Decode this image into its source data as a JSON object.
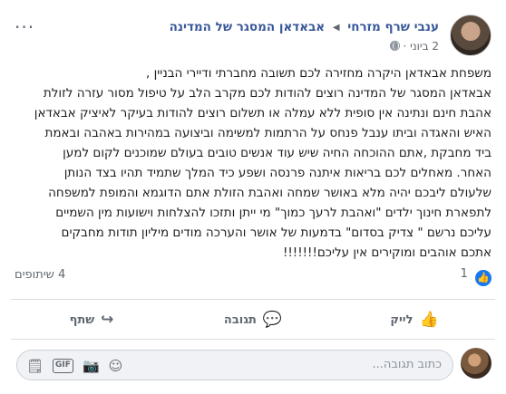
{
  "header": {
    "author": "ענבי שרף מזרחי",
    "group": "אבאדאן המסגר של המדינה",
    "date": "2 ביוני"
  },
  "post": {
    "lines": [
      "משפחת אבאדאן היקרה מחזירה לכם תשובה מחברתי ודיירי הבניין ,",
      "אבאדאן המסגר של המדינה רוצים להודות לכם מקרב הלב על טיפול מסור עזרה לזולת",
      "אהבת חינם ונתינה אין סופית ללא עמלה או תשלום רוצים להודות בעיקר לאיציק אבאדאן",
      "האיש והאגדה וביתו ענבל פנחס על הרתמות למשימה וביצועה במהירות באהבה ובאמת",
      "ביד מחבקת ,אתם ההוכחה החיה שיש עוד אנשים טובים בעולם שמוכנים לקום למען",
      "האחר. מאחלים לכם בריאות איתנה פרנסה ושפע כיד המלך שתמיד תהיו בצד הנותן",
      "שלעולם ליבכם יהיה מלא באושר שמחה ואהבת הזולת אתם הדוגמא והמופת למשפחה",
      "לתפארת חינוך ילדים \"ואהבת לרעך כמוך\" מי ייתן ותזכו להצלחות וישועות מין השמיים",
      "עליכם נרשם \" צדיק בסדום\" בדמעות של אושר והערכה מודים מיליון תודות מחבקים",
      "אתכם אוהבים ומוקירים אין עליכם!!!!!!!"
    ]
  },
  "stats": {
    "likes": "1",
    "shares": "4 שיתופים"
  },
  "actions": {
    "like": "לייק",
    "comment": "תגובה",
    "share": "שתף"
  },
  "comment_box": {
    "placeholder": "כתוב תגובה..."
  },
  "colors": {
    "link": "#385898",
    "like_blue": "#1877f2",
    "muted": "#606770"
  },
  "icons": {
    "like": "thumbs-up-icon",
    "comment": "speech-bubble-icon",
    "share": "share-arrow-icon",
    "privacy": "globe-icon",
    "more": "ellipsis-icon"
  }
}
